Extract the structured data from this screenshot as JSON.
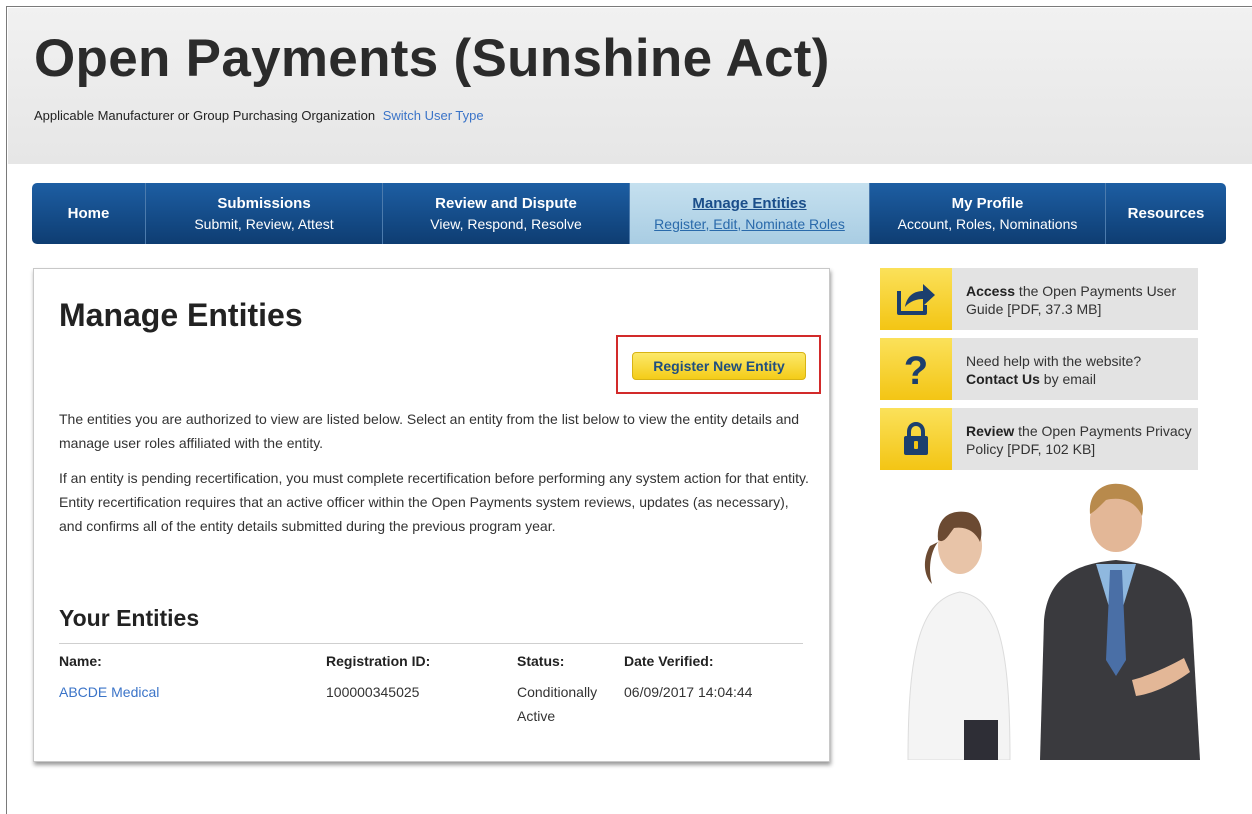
{
  "header": {
    "title": "Open Payments (Sunshine Act)",
    "user_type": "Applicable Manufacturer or Group Purchasing Organization",
    "switch_link": "Switch User Type"
  },
  "nav": {
    "home": "Home",
    "submissions": {
      "title": "Submissions",
      "sub": "Submit, Review, Attest"
    },
    "review": {
      "title": "Review and Dispute",
      "sub": "View, Respond, Resolve"
    },
    "manage": {
      "title": "Manage Entities",
      "sub": "Register, Edit, Nominate Roles"
    },
    "profile": {
      "title": "My Profile",
      "sub": "Account, Roles, Nominations"
    },
    "resources": "Resources"
  },
  "main": {
    "title": "Manage Entities",
    "register_button": "Register New Entity",
    "intro": "The entities you are authorized to view are listed below. Select an entity from the list below to view the entity details and manage user roles affiliated with the entity.",
    "recert": "If an entity is pending recertification, you must complete recertification before performing any system action for that entity. Entity recertification requires that an active officer within the Open Payments system reviews, updates (as necessary), and confirms all of the entity details submitted during the previous program year.",
    "entities_heading": "Your Entities",
    "columns": [
      "Name:",
      "Registration ID:",
      "Status:",
      "Date Verified:"
    ],
    "rows": [
      {
        "name": "ABCDE Medical",
        "registration_id": "100000345025",
        "status": "Conditionally Active",
        "date_verified": "06/09/2017 14:04:44"
      }
    ]
  },
  "sidebar": {
    "guide": {
      "bold": "Access",
      "text": " the Open Payments User Guide [PDF, 37.3 MB]",
      "icon": "share-arrow-icon"
    },
    "help": {
      "text": "Need help with the website? ",
      "bold": "Contact Us",
      "text2": " by email",
      "icon": "question-mark-icon"
    },
    "privacy": {
      "bold": "Review",
      "text": " the Open Payments Privacy Policy [PDF, 102 KB]",
      "icon": "lock-icon"
    }
  },
  "colors": {
    "nav_blue": "#1d5ea3",
    "nav_active": "#c5e0ef",
    "accent_yellow": "#f4cc18",
    "link_blue": "#3b74c8",
    "highlight_red": "#d22a2a"
  }
}
